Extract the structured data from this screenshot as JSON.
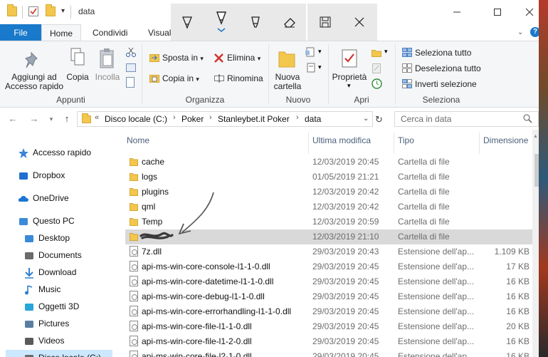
{
  "window": {
    "title": "data"
  },
  "tabs": [
    {
      "label": "File"
    },
    {
      "label": "Home"
    },
    {
      "label": "Condividi"
    },
    {
      "label": "Visual"
    }
  ],
  "ribbon": {
    "groups": [
      {
        "label": "Appunti"
      },
      {
        "label": "Organizza"
      },
      {
        "label": "Nuovo"
      },
      {
        "label": "Apri"
      },
      {
        "label": "Seleziona"
      }
    ],
    "pin_label_1": "Aggiungi ad",
    "pin_label_2": "Accesso rapido",
    "copy_label": "Copia",
    "paste_label": "Incolla",
    "move_label": "Sposta in",
    "copy_to_label": "Copia in",
    "delete_label": "Elimina",
    "rename_label": "Rinomina",
    "new_folder_1": "Nuova",
    "new_folder_2": "cartella",
    "properties_label": "Proprietà",
    "select_all_label": "Seleziona tutto",
    "select_none_label": "Deseleziona tutto",
    "invert_label": "Inverti selezione"
  },
  "address": {
    "crumbs": [
      "Disco locale (C:)",
      "Poker",
      "Stanleybet.it Poker",
      "data"
    ],
    "search_placeholder": "Cerca in data"
  },
  "nav": [
    {
      "label": "Accesso rapido",
      "icon": "star-icon",
      "color": "#3c84d8"
    },
    {
      "label": "Dropbox",
      "icon": "dropbox-icon",
      "color": "#1f6fd1"
    },
    {
      "label": "OneDrive",
      "icon": "cloud-icon",
      "color": "#1d76d2"
    },
    {
      "label": "Questo PC",
      "icon": "computer-icon",
      "color": "#3a8ad7"
    },
    {
      "label": "Desktop",
      "icon": "desktop-icon",
      "color": "#3a8ad7"
    },
    {
      "label": "Documents",
      "icon": "documents-icon",
      "color": "#6b6b6b"
    },
    {
      "label": "Download",
      "icon": "download-icon",
      "color": "#2f7fd0"
    },
    {
      "label": "Music",
      "icon": "music-icon",
      "color": "#2f7fd0"
    },
    {
      "label": "Oggetti 3D",
      "icon": "cube-icon",
      "color": "#29a6d9"
    },
    {
      "label": "Pictures",
      "icon": "pictures-icon",
      "color": "#5a7ea3"
    },
    {
      "label": "Videos",
      "icon": "videos-icon",
      "color": "#5a5a5a"
    },
    {
      "label": "Disco locale (C:)",
      "icon": "drive-icon",
      "color": "#6b6b6b"
    }
  ],
  "columns": {
    "name": "Nome",
    "modified": "Ultima modifica",
    "type": "Tipo",
    "size": "Dimensione"
  },
  "files": [
    {
      "name": "cache",
      "date": "12/03/2019 20:45",
      "type": "Cartella di file",
      "size": "",
      "kind": "folder"
    },
    {
      "name": "logs",
      "date": "01/05/2019 21:21",
      "type": "Cartella di file",
      "size": "",
      "kind": "folder"
    },
    {
      "name": "plugins",
      "date": "12/03/2019 20:42",
      "type": "Cartella di file",
      "size": "",
      "kind": "folder"
    },
    {
      "name": "qml",
      "date": "12/03/2019 20:42",
      "type": "Cartella di file",
      "size": "",
      "kind": "folder"
    },
    {
      "name": "Temp",
      "date": "12/03/2019 20:59",
      "type": "Cartella di file",
      "size": "",
      "kind": "folder"
    },
    {
      "name": "",
      "date": "12/03/2019 21:10",
      "type": "Cartella di file",
      "size": "",
      "kind": "folder",
      "selected": true
    },
    {
      "name": "7z.dll",
      "date": "29/03/2019 20:43",
      "type": "Estensione dell'ap...",
      "size": "1.109 KB",
      "kind": "dll"
    },
    {
      "name": "api-ms-win-core-console-l1-1-0.dll",
      "date": "29/03/2019 20:45",
      "type": "Estensione dell'ap...",
      "size": "17 KB",
      "kind": "dll"
    },
    {
      "name": "api-ms-win-core-datetime-l1-1-0.dll",
      "date": "29/03/2019 20:45",
      "type": "Estensione dell'ap...",
      "size": "16 KB",
      "kind": "dll"
    },
    {
      "name": "api-ms-win-core-debug-l1-1-0.dll",
      "date": "29/03/2019 20:45",
      "type": "Estensione dell'ap...",
      "size": "16 KB",
      "kind": "dll"
    },
    {
      "name": "api-ms-win-core-errorhandling-l1-1-0.dll",
      "date": "29/03/2019 20:45",
      "type": "Estensione dell'ap...",
      "size": "16 KB",
      "kind": "dll"
    },
    {
      "name": "api-ms-win-core-file-l1-1-0.dll",
      "date": "29/03/2019 20:45",
      "type": "Estensione dell'ap...",
      "size": "20 KB",
      "kind": "dll"
    },
    {
      "name": "api-ms-win-core-file-l1-2-0.dll",
      "date": "29/03/2019 20:45",
      "type": "Estensione dell'ap...",
      "size": "16 KB",
      "kind": "dll"
    },
    {
      "name": "api-ms-win-core-file-l2-1-0.dll",
      "date": "29/03/2019 20:45",
      "type": "Estensione dell'ap...",
      "size": "16 KB",
      "kind": "dll"
    }
  ],
  "colors": {
    "accent": "#1979ca",
    "folder": "#f3c74e",
    "selection": "#d9d9d9"
  }
}
